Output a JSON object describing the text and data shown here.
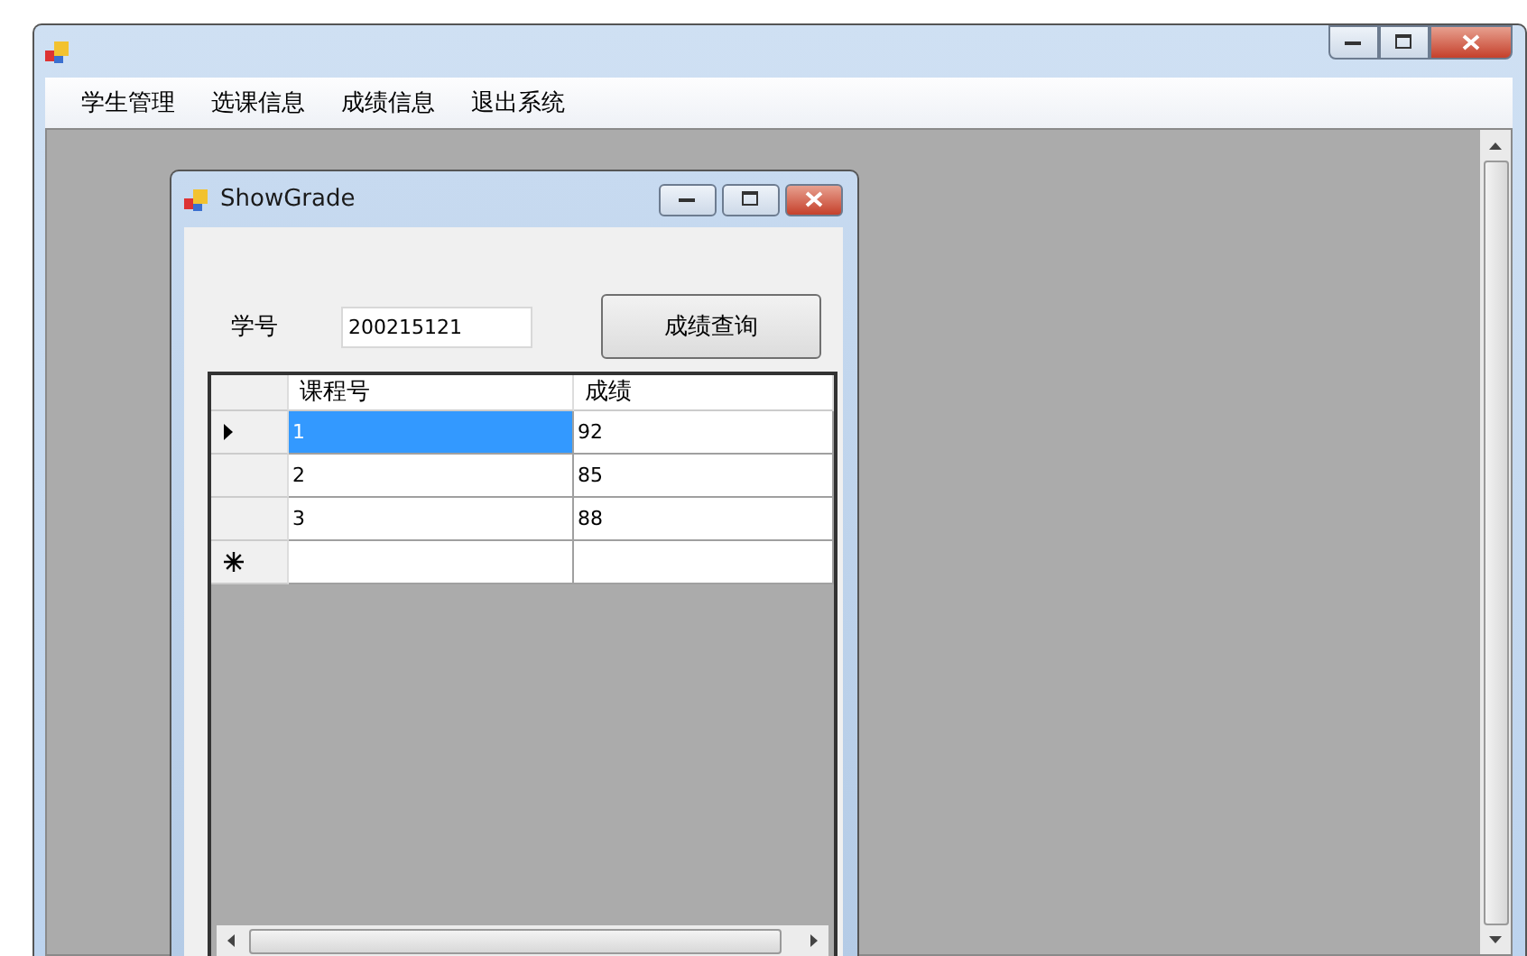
{
  "main_window": {
    "menu": [
      {
        "label": "学生管理"
      },
      {
        "label": "选课信息"
      },
      {
        "label": "成绩信息"
      },
      {
        "label": "退出系统"
      }
    ]
  },
  "child_window": {
    "title": "ShowGrade",
    "form": {
      "label": "学号",
      "value": "200215121",
      "button": "成绩查询"
    },
    "grid": {
      "columns": [
        "课程号",
        "成绩"
      ],
      "rows": [
        {
          "kind": "data",
          "selected": true,
          "cells": [
            "1",
            "92"
          ]
        },
        {
          "kind": "data",
          "selected": false,
          "cells": [
            "2",
            "85"
          ]
        },
        {
          "kind": "data",
          "selected": false,
          "cells": [
            "3",
            "88"
          ]
        },
        {
          "kind": "new",
          "selected": false,
          "cells": [
            "",
            ""
          ]
        }
      ]
    }
  }
}
